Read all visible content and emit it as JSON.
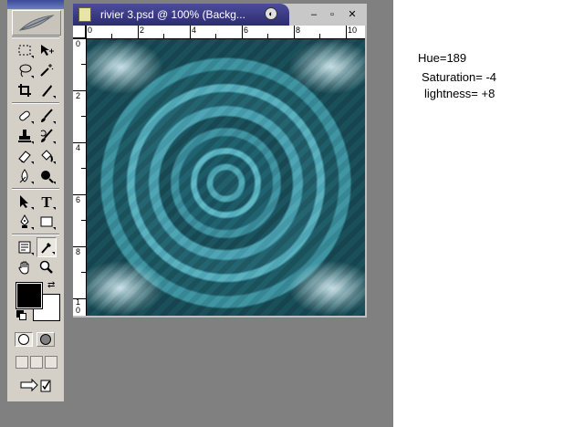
{
  "document": {
    "title": "rivier 3.psd @ 100% (Backg...",
    "minimize_label": "–",
    "maximize_label": "▫",
    "close_label": "✕"
  },
  "rulers": {
    "top": [
      "0",
      "2",
      "4",
      "6",
      "8",
      "10"
    ],
    "left": [
      "0",
      "2",
      "4",
      "6",
      "8",
      "1",
      "0"
    ]
  },
  "toolbox": {
    "tools": [
      "rectangular-marquee-tool",
      "move-tool",
      "lasso-tool",
      "magic-wand-tool",
      "crop-tool",
      "slice-tool",
      "healing-brush-tool",
      "brush-tool",
      "clone-stamp-tool",
      "history-brush-tool",
      "eraser-tool",
      "paint-bucket-tool",
      "blur-tool",
      "burn-tool",
      "path-selection-tool",
      "type-tool",
      "pen-tool",
      "rectangle-shape-tool",
      "notes-tool",
      "eyedropper-tool",
      "hand-tool",
      "zoom-tool"
    ],
    "foreground_color": "#000000",
    "background_color": "#ffffff"
  },
  "annotation": {
    "hue": "Hue=189",
    "saturation": "Saturation= -4",
    "lightness": "lightness= +8"
  }
}
